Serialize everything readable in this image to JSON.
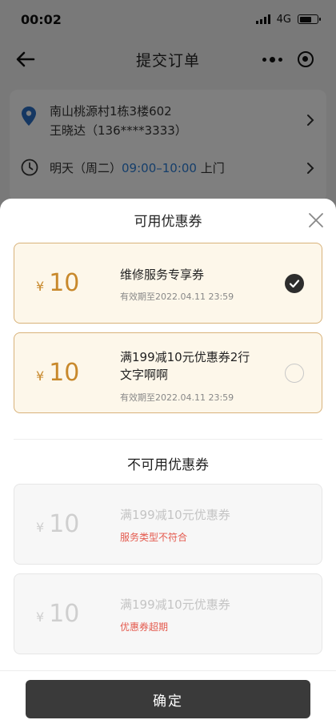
{
  "status_bar": {
    "time": "00:02",
    "network": "4G"
  },
  "nav": {
    "title": "提交订单"
  },
  "address": {
    "line1": "南山桃源村1栋3楼602",
    "line2": "王晓达（136****3333）"
  },
  "service_time": {
    "prefix": "明天（周二）",
    "range": "09:00–10:00",
    "suffix": " 上门"
  },
  "sheet": {
    "title": "可用优惠券",
    "available": [
      {
        "yen": "¥",
        "amount": "10",
        "name": "维修服务专享券",
        "valid": "有效期至2022.04.11 23:59",
        "selected": true
      },
      {
        "yen": "¥",
        "amount": "10",
        "name": "满199减10元优惠券2行文字啊啊",
        "valid": "有效期至2022.04.11 23:59",
        "selected": false
      }
    ],
    "unavailable_title": "不可用优惠券",
    "unavailable": [
      {
        "yen": "¥",
        "amount": "10",
        "name": "满199减10元优惠券",
        "reason": "服务类型不符合"
      },
      {
        "yen": "¥",
        "amount": "10",
        "name": "满199减10元优惠券",
        "reason": "优惠券超期"
      }
    ],
    "confirm_label": "确定"
  },
  "colors": {
    "accent_gold": "#c8892c",
    "coupon_bg": "#fdf7ea",
    "reason_red": "#e45a4e",
    "time_blue": "#2a7dd6",
    "button_dark": "#3a3a3a"
  }
}
